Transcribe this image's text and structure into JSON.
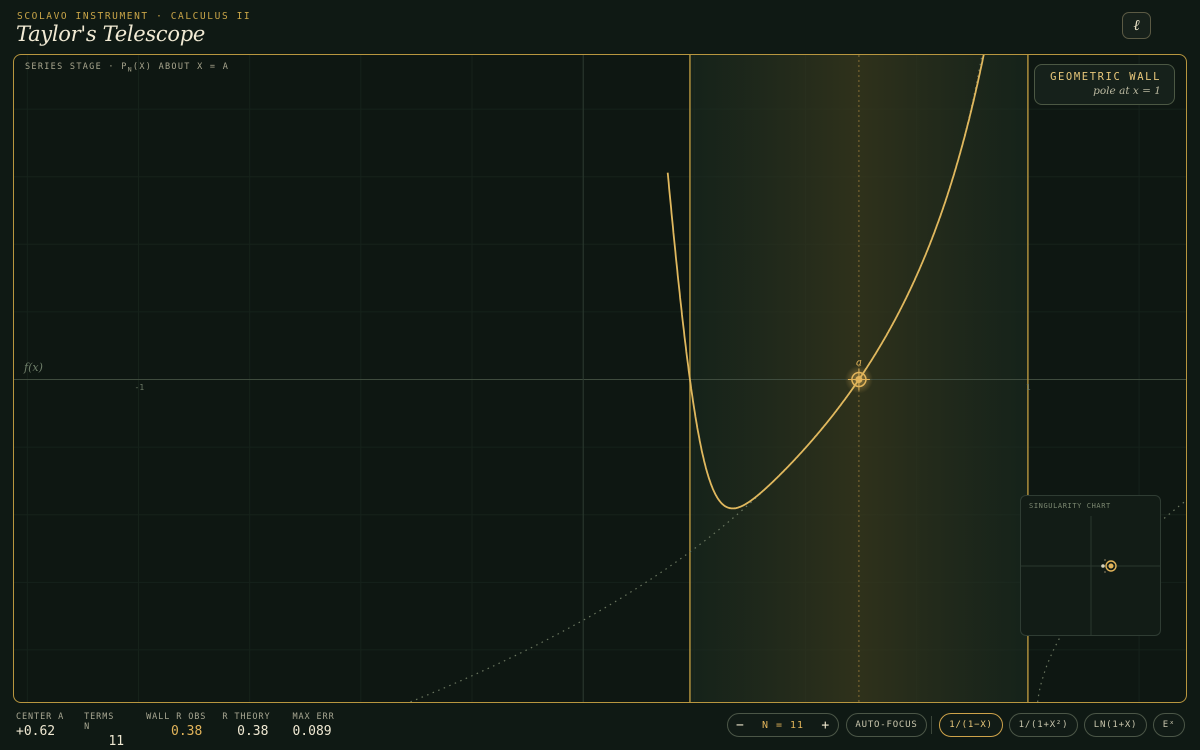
{
  "header": {
    "kicker": "SCOLAVO INSTRUMENT · CALCULUS II",
    "title": "Taylor's Telescope",
    "logo_glyph": "ℓ"
  },
  "stage": {
    "label_prefix": "SERIES STAGE · P",
    "label_sub": "N",
    "label_suffix": "(X) ABOUT X = A",
    "wall_title": "GEOMETRIC WALL",
    "wall_subtitle": "pole at x = 1",
    "y_label": "f(x)",
    "tick_minus1": "-1",
    "tick_1": "1",
    "center_marker_label": "a",
    "singularity_chart_title": "SINGULARITY CHART"
  },
  "stats": {
    "center_a_label": "CENTER A",
    "center_a_value": "+0.62",
    "terms_n_label": "TERMS N",
    "terms_n_value": "11",
    "wall_r_obs_label": "WALL R OBS",
    "wall_r_obs_value": "0.38",
    "r_theory_label": "R THEORY",
    "r_theory_value": "0.38",
    "max_err_label": "MAX ERR",
    "max_err_value": "0.089"
  },
  "controls": {
    "minus": "−",
    "n_display": "N = 11",
    "plus": "+",
    "auto_focus": "AUTO-FOCUS",
    "fn_1": "1/(1−X)",
    "fn_2": "1/(1+X²)",
    "fn_3": "LN(1+X)",
    "fn_4": "Eˣ"
  },
  "colors": {
    "accent_gold": "#e2b45a",
    "frame_gold": "#b8963f",
    "background": "#0f1914"
  },
  "model": {
    "function": "1/(1-x)",
    "center": 0.62,
    "terms": 11,
    "radius": 0.38,
    "x_range": [
      -1.28,
      1.36
    ],
    "y_range": [
      -1.2,
      1.2
    ]
  }
}
